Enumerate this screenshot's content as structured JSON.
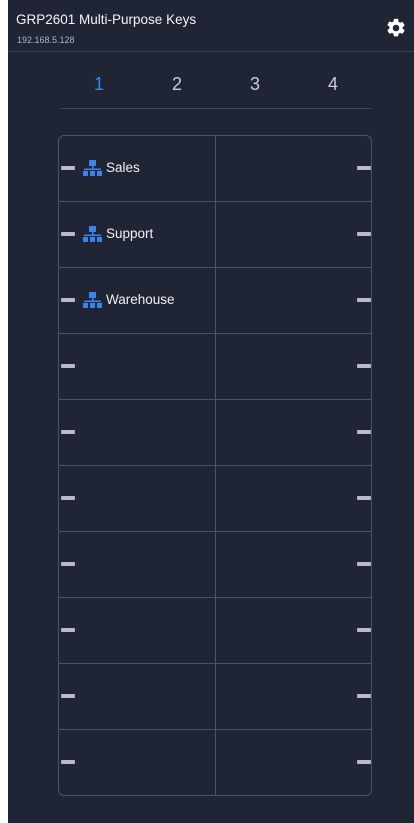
{
  "header": {
    "title": "GRP2601 Multi-Purpose Keys",
    "ip": "192.168.5.128",
    "settings_icon": "gear-icon"
  },
  "tabs": [
    {
      "label": "1",
      "active": true
    },
    {
      "label": "2",
      "active": false
    },
    {
      "label": "3",
      "active": false
    },
    {
      "label": "4",
      "active": false
    }
  ],
  "keys": {
    "left": [
      {
        "label": "Sales",
        "icon": "network-group-icon"
      },
      {
        "label": "Support",
        "icon": "network-group-icon"
      },
      {
        "label": "Warehouse",
        "icon": "network-group-icon"
      },
      {
        "label": ""
      },
      {
        "label": ""
      },
      {
        "label": ""
      },
      {
        "label": ""
      },
      {
        "label": ""
      },
      {
        "label": ""
      },
      {
        "label": ""
      }
    ],
    "right": [
      {
        "label": ""
      },
      {
        "label": ""
      },
      {
        "label": ""
      },
      {
        "label": ""
      },
      {
        "label": ""
      },
      {
        "label": ""
      },
      {
        "label": ""
      },
      {
        "label": ""
      },
      {
        "label": ""
      },
      {
        "label": ""
      }
    ]
  },
  "colors": {
    "background": "#1f2535",
    "accent": "#3d84e8",
    "border": "#4b5366",
    "led": "#b7bcc6"
  }
}
